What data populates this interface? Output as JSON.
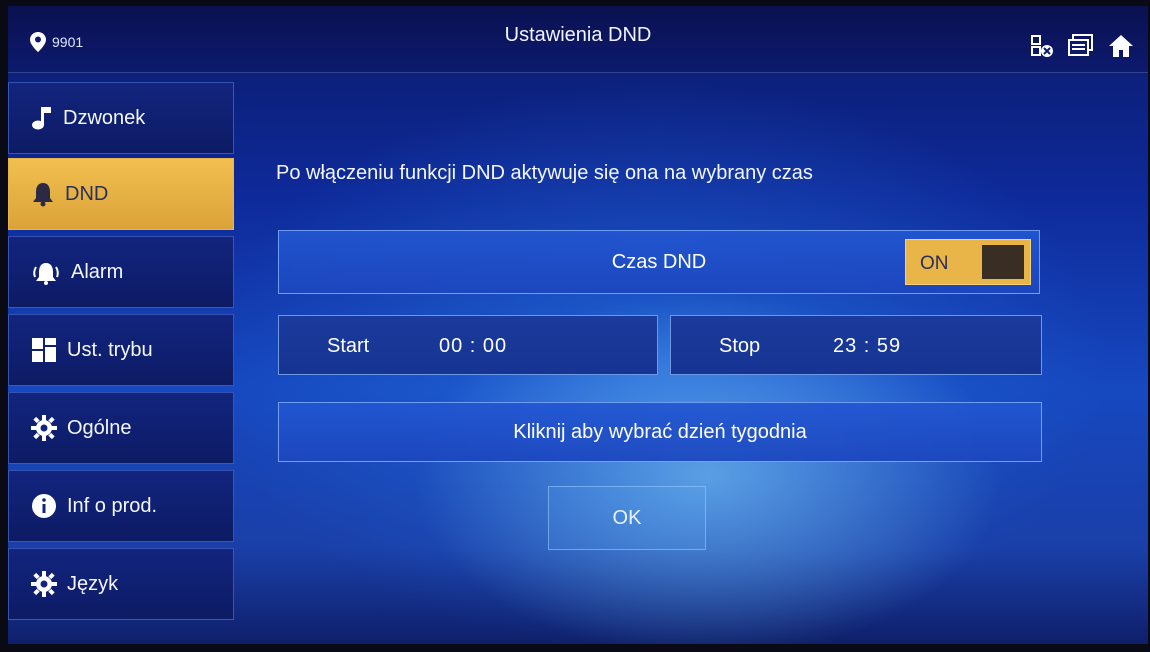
{
  "header": {
    "location_code": "9901",
    "title": "Ustawienia DND"
  },
  "sidebar": {
    "items": [
      {
        "label": "Dzwonek",
        "icon": "music-note-icon"
      },
      {
        "label": "DND",
        "icon": "bell-icon",
        "active": true
      },
      {
        "label": "Alarm",
        "icon": "alarm-icon"
      },
      {
        "label": "Ust. trybu",
        "icon": "grid-icon"
      },
      {
        "label": "Ogólne",
        "icon": "gear-icon"
      },
      {
        "label": "Inf o prod.",
        "icon": "info-icon"
      },
      {
        "label": "Język",
        "icon": "gear-icon"
      }
    ]
  },
  "main": {
    "description": "Po włączeniu funkcji DND aktywuje się ona na wybrany czas",
    "dnd_time_label": "Czas DND",
    "toggle_state": "ON",
    "start_label": "Start",
    "start_time": "00 : 00",
    "stop_label": "Stop",
    "stop_time": "23 : 59",
    "weekday_label": "Kliknij aby wybrać dzień tygodnia",
    "ok_label": "OK"
  },
  "colors": {
    "accent": "#e9b548",
    "background": "#0e2a9a"
  }
}
